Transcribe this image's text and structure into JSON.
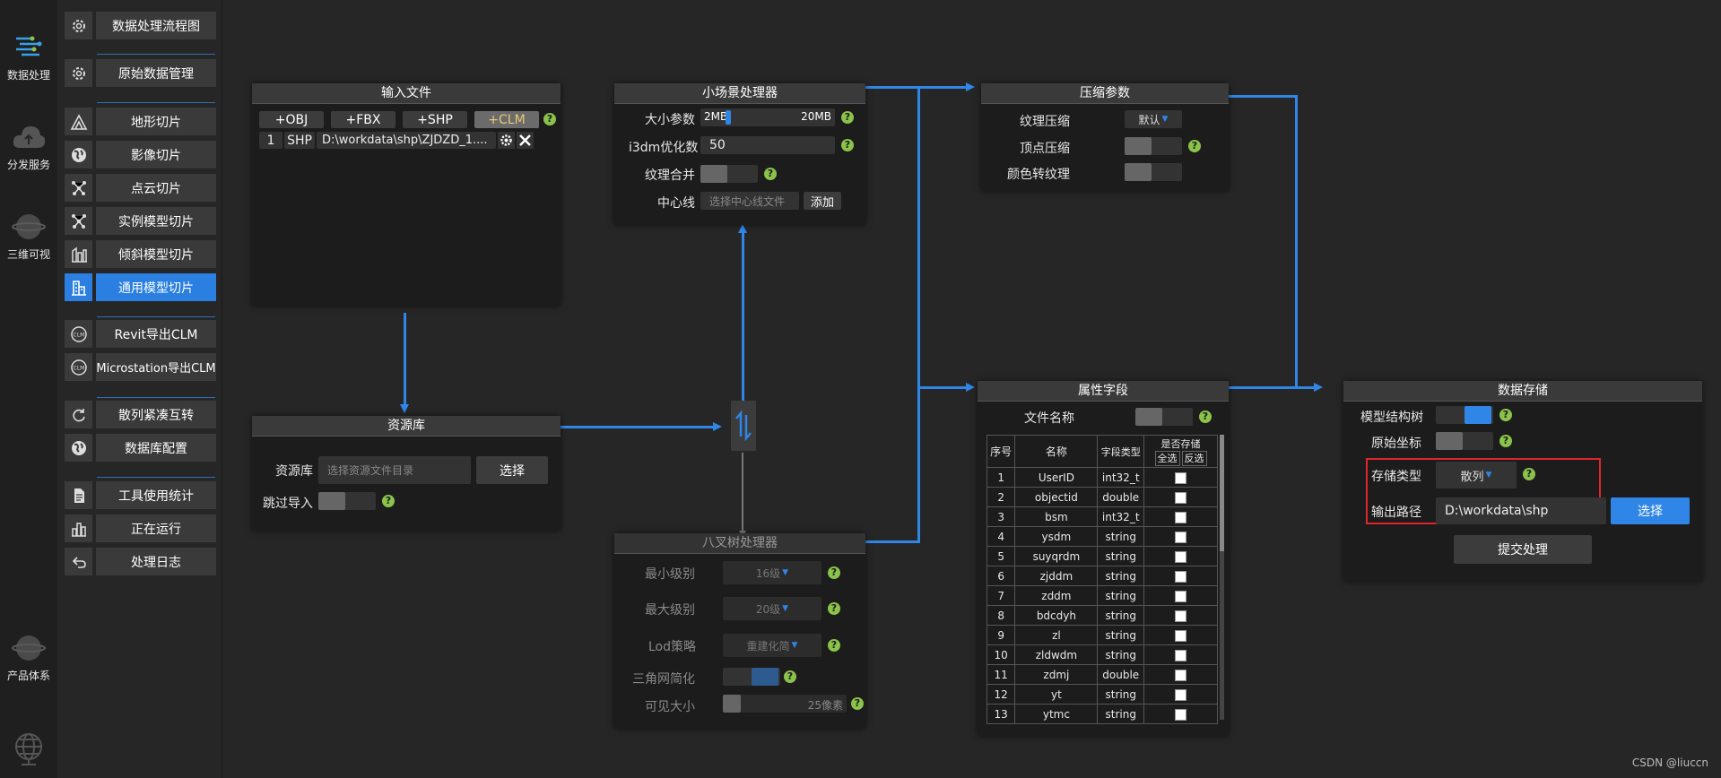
{
  "rail": [
    {
      "label": "数据处理",
      "icon": "data-processing-icon"
    },
    {
      "label": "分发服务",
      "icon": "cloud-icon"
    },
    {
      "label": "三维可视",
      "icon": "globe-3d-icon"
    },
    {
      "label": "产品体系",
      "icon": "product-globe-icon"
    }
  ],
  "menu": {
    "items": [
      {
        "label": "数据处理流程图",
        "icon": "gear-icon"
      },
      {
        "label": "原始数据管理",
        "icon": "gear-icon"
      },
      {
        "label": "地形切片",
        "icon": "terrain-icon"
      },
      {
        "label": "影像切片",
        "icon": "earth-icon"
      },
      {
        "label": "点云切片",
        "icon": "point-cloud-icon"
      },
      {
        "label": "实例模型切片",
        "icon": "point-cloud-icon"
      },
      {
        "label": "倾斜模型切片",
        "icon": "oblique-model-icon"
      },
      {
        "label": "通用模型切片",
        "icon": "building-icon"
      },
      {
        "label": "Revit导出CLM",
        "icon": "revit-icon"
      },
      {
        "label": "Microstation导出CLM",
        "icon": "microstation-icon"
      },
      {
        "label": "散列紧凑互转",
        "icon": "refresh-icon"
      },
      {
        "label": "数据库配置",
        "icon": "earth-icon"
      },
      {
        "label": "工具使用统计",
        "icon": "document-icon"
      },
      {
        "label": "正在运行",
        "icon": "bar-chart-icon"
      },
      {
        "label": "处理日志",
        "icon": "return-icon"
      }
    ],
    "active_label": "通用模型切片"
  },
  "input_file": {
    "title": "输入文件",
    "buttons": [
      "+OBJ",
      "+FBX",
      "+SHP",
      "+CLM"
    ],
    "row": {
      "index": "1",
      "type": "SHP",
      "path": "D:\\workdata\\shp\\ZJDZD_1...."
    }
  },
  "small_scene": {
    "title": "小场景处理器",
    "size_label": "大小参数",
    "size_min": "2MB",
    "size_max": "20MB",
    "size_fraction": 0.05,
    "i3dm_label": "i3dm优化数",
    "i3dm_value": "50",
    "texture_merge_label": "纹理合并",
    "centerline_label": "中心线",
    "centerline_placeholder": "选择中心线文件",
    "add_label": "添加"
  },
  "compress": {
    "title": "压缩参数",
    "texture_label": "纹理压缩",
    "texture_value": "默认",
    "vertex_label": "顶点压缩",
    "color_label": "颜色转纹理"
  },
  "resource": {
    "title": "资源库",
    "lib_label": "资源库",
    "lib_placeholder": "选择资源文件目录",
    "select_label": "选择",
    "skip_label": "跳过导入"
  },
  "octree": {
    "title": "八叉树处理器",
    "min_level_label": "最小级别",
    "min_level_value": "16级",
    "max_level_label": "最大级别",
    "max_level_value": "20级",
    "lod_label": "Lod策略",
    "lod_value": "重建化简",
    "mesh_label": "三角网简化",
    "visible_label": "可见大小",
    "visible_value": "25像素",
    "visible_fraction": 0.0
  },
  "attributes": {
    "title": "属性字段",
    "filename_label": "文件名称",
    "headers": {
      "index": "序号",
      "name": "名称",
      "type": "字段类型",
      "store": "是否存储",
      "select_all": "全选",
      "invert": "反选"
    },
    "rows": [
      {
        "no": "1",
        "name": "UserID",
        "type": "int32_t"
      },
      {
        "no": "2",
        "name": "objectid",
        "type": "double"
      },
      {
        "no": "3",
        "name": "bsm",
        "type": "int32_t"
      },
      {
        "no": "4",
        "name": "ysdm",
        "type": "string"
      },
      {
        "no": "5",
        "name": "suyqrdm",
        "type": "string"
      },
      {
        "no": "6",
        "name": "zjddm",
        "type": "string"
      },
      {
        "no": "7",
        "name": "zddm",
        "type": "string"
      },
      {
        "no": "8",
        "name": "bdcdyh",
        "type": "string"
      },
      {
        "no": "9",
        "name": "zl",
        "type": "string"
      },
      {
        "no": "10",
        "name": "zldwdm",
        "type": "string"
      },
      {
        "no": "11",
        "name": "zdmj",
        "type": "double"
      },
      {
        "no": "12",
        "name": "yt",
        "type": "string"
      },
      {
        "no": "13",
        "name": "ytmc",
        "type": "string"
      }
    ]
  },
  "storage": {
    "title": "数据存储",
    "tree_label": "模型结构树",
    "origin_label": "原始坐标",
    "type_label": "存储类型",
    "type_value": "散列",
    "output_label": "输出路径",
    "output_value": "D:\\workdata\\shp",
    "select_label": "选择",
    "submit_label": "提交处理",
    "highlight_color": "#e0262b"
  },
  "watermark": "CSDN @liuccn",
  "colors": {
    "accent": "#2f86e6",
    "help": "#8bc34a",
    "bg": "#262626"
  }
}
